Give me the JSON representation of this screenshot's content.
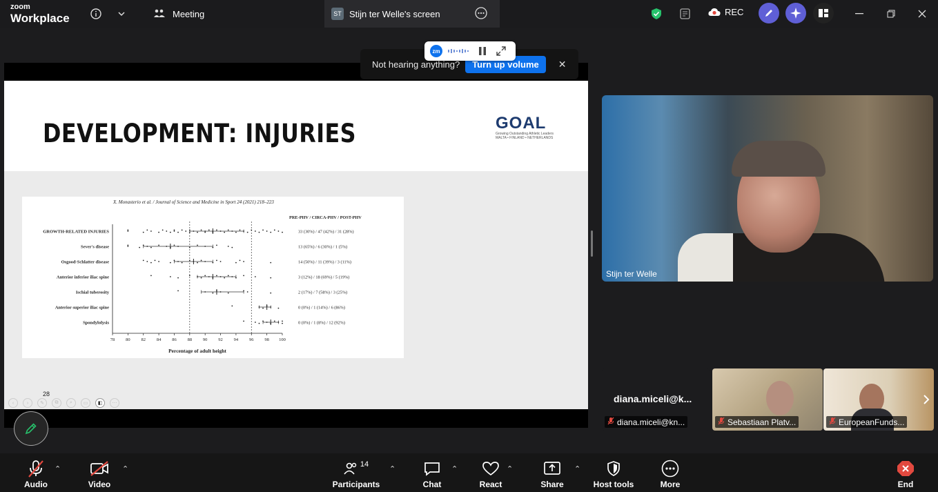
{
  "app": {
    "brand_small": "zoom",
    "brand_big": "Workplace"
  },
  "tabs": [
    {
      "label": "Meeting"
    },
    {
      "label": "Stijn ter Welle's screen",
      "badge": "ST"
    }
  ],
  "rec_label": "REC",
  "banner": {
    "message": "Not hearing anything?",
    "button": "Turn up volume"
  },
  "mini_bar": {
    "logo": "zm"
  },
  "slide": {
    "title": "DEVELOPMENT: INJURIES",
    "logo_text": "GOAL",
    "logo_sub": "Growing Outstanding Athletic Leaders",
    "logo_sub2": "MALTA • FINLAND • NETHERLANDS",
    "page_number": "28"
  },
  "chart_data": {
    "type": "scatter",
    "title": "X. Monasterio et al. / Journal of Science and Medicine in Sport 24 (2021) 218–223",
    "xlabel": "Percentage of adult height",
    "x_ticks": [
      78,
      80,
      82,
      84,
      86,
      88,
      90,
      92,
      94,
      96,
      98,
      100
    ],
    "xlim": [
      78,
      100
    ],
    "reference_lines": [
      88,
      96
    ],
    "column_header": "PRE-PHV / CIRCA-PHV / POST-PHV",
    "rows": [
      {
        "label": "GROWTH-RELATED INJURIES",
        "stats": "33 (30%)   /   47 (42%)   /   31 (28%)",
        "median": 91,
        "q1": 88,
        "q3": 95,
        "points": [
          80,
          80,
          82,
          82.5,
          83,
          84,
          84.5,
          85,
          85.5,
          86,
          86,
          86.5,
          87,
          87.5,
          88,
          88,
          88.5,
          89,
          89.5,
          90,
          90,
          90.5,
          91,
          91,
          91.5,
          92,
          92.5,
          93,
          93.5,
          94,
          94.5,
          95,
          95.5,
          96,
          96.5,
          97,
          97.5,
          98,
          98.5,
          99,
          99.5,
          100
        ]
      },
      {
        "label": "Sever's disease",
        "stats": "13 (65%)   /   6 (30%)   /   1  (5%)",
        "median": 85.5,
        "q1": 82,
        "q3": 91,
        "points": [
          80,
          80,
          81.5,
          82,
          82.5,
          83,
          84,
          85,
          85.5,
          86,
          86.5,
          88,
          89,
          90,
          91,
          91.5,
          93,
          93.5
        ]
      },
      {
        "label": "Osgood-Schlatter disease",
        "stats": "14 (50%)   /   11 (39%)   /   3 (11%)",
        "median": 88.5,
        "q1": 86,
        "q3": 91,
        "points": [
          82,
          82.5,
          83,
          83.5,
          84,
          85.5,
          86,
          86.5,
          87,
          88,
          88.5,
          89,
          89.5,
          90,
          91,
          91.5,
          92,
          94,
          94.5,
          95,
          98.5
        ]
      },
      {
        "label": "Anterior inferior iliac spine",
        "stats": "3 (12%)   /   18 (69%)   /   5 (19%)",
        "median": 91,
        "q1": 89,
        "q3": 94,
        "points": [
          83,
          85.5,
          86.5,
          88,
          89,
          89.5,
          90,
          90.5,
          91,
          91.5,
          92,
          92.5,
          93,
          93.5,
          94,
          95,
          96.5,
          98.5
        ]
      },
      {
        "label": "Ischial tuberosity",
        "stats": "2 (17%)   /   7 (58%)   /   3 (25%)",
        "median": 91.5,
        "q1": 89.5,
        "q3": 95,
        "points": [
          86.5,
          90,
          91,
          91.5,
          92,
          93,
          95,
          95.5,
          98.5
        ]
      },
      {
        "label": "Anterior superior iliac spine",
        "stats": "0 (0%)   /   1  (14%)   /   6 (86%)",
        "median": 98,
        "q1": 97,
        "q3": 98.5,
        "points": [
          93.5,
          97,
          97.5,
          98,
          98.5,
          99.5
        ]
      },
      {
        "label": "Spondylolysis",
        "stats": "0 (0%)   /   1 (8%)   /   12 (92%)",
        "median": 98.5,
        "q1": 97.5,
        "q3": 99.5,
        "points": [
          95,
          96.5,
          97,
          97.5,
          98,
          98.5,
          99,
          99.5,
          100,
          100
        ]
      }
    ]
  },
  "speaker": {
    "name": "Stijn ter Welle"
  },
  "participants_strip": [
    {
      "name": "diana.miceli@k...",
      "label": "diana.miceli@kn..."
    },
    {
      "label": "Sebastiaan Platv..."
    },
    {
      "label": "EuropeanFunds..."
    }
  ],
  "toolbar": {
    "audio": "Audio",
    "video": "Video",
    "participants": "Participants",
    "participants_count": "14",
    "chat": "Chat",
    "react": "React",
    "share": "Share",
    "host_tools": "Host tools",
    "more": "More",
    "end": "End"
  },
  "colors": {
    "accent": "#0e72ed",
    "end": "#e2493f",
    "shield": "#27c26c",
    "ai_purple": "#5f5fd6"
  }
}
